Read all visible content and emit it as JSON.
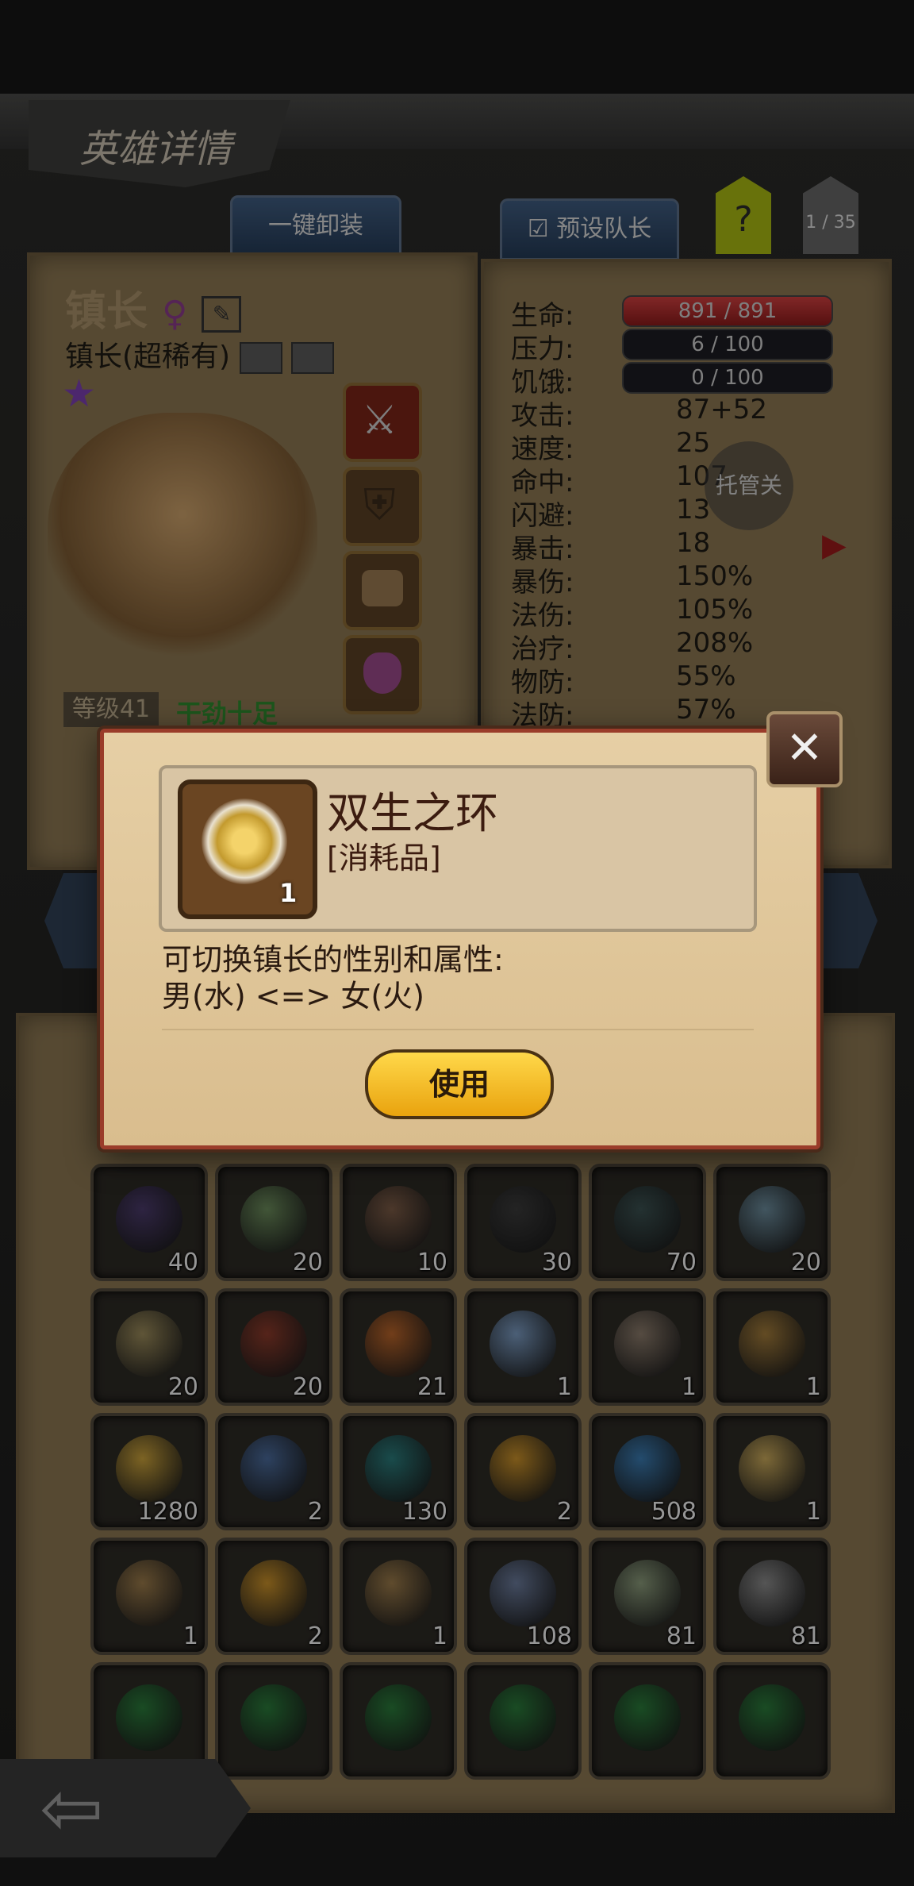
{
  "header": {
    "title": "英雄详情",
    "unequip_label": "一键卸装",
    "leader_label": "预设队长",
    "help_label": "?",
    "page_indicator": "1 / 35"
  },
  "hero": {
    "name": "镇长",
    "gender_icon": "female-symbol-icon",
    "subtitle": "镇长(超稀有)",
    "star": "★",
    "level": "等级41",
    "mood": "干劲十足",
    "star_color": "#7b3fb0"
  },
  "stats": {
    "hp": {
      "label": "生命:",
      "value": "891 / 891"
    },
    "stress": {
      "label": "压力:",
      "value": "6 / 100"
    },
    "hunger": {
      "label": "饥饿:",
      "value": "0 / 100"
    },
    "rows": [
      {
        "label": "攻击:",
        "value": "87+52"
      },
      {
        "label": "速度:",
        "value": "25"
      },
      {
        "label": "命中:",
        "value": "107"
      },
      {
        "label": "闪避:",
        "value": "13"
      },
      {
        "label": "暴击:",
        "value": "18"
      },
      {
        "label": "暴伤:",
        "value": "150%"
      },
      {
        "label": "法伤:",
        "value": "105%"
      },
      {
        "label": "治疗:",
        "value": "208%"
      },
      {
        "label": "物防:",
        "value": "55%"
      },
      {
        "label": "法防:",
        "value": "57%"
      }
    ],
    "auto_label": "托管关"
  },
  "dialog": {
    "item_name": "双生之环",
    "item_type": "[消耗品]",
    "item_qty": "1",
    "desc_line1": "可切换镇长的性别和属性:",
    "desc_line2": "男(水) <=> 女(火)",
    "use_label": "使用",
    "close_icon": "close-x-icon"
  },
  "inventory": [
    [
      {
        "icon": "hero-dark-hair",
        "qty": "40",
        "color": "#4a3a6a"
      },
      {
        "icon": "hero-green-hair",
        "qty": "20",
        "color": "#6a8a5a"
      },
      {
        "icon": "hero-brown-hair",
        "qty": "10",
        "color": "#7a5a45"
      },
      {
        "icon": "hero-black-hair",
        "qty": "30",
        "color": "#3a3a3a"
      },
      {
        "icon": "hero-teal-hair",
        "qty": "70",
        "color": "#3a5050"
      },
      {
        "icon": "hero-blue-hair",
        "qty": "20",
        "color": "#6a8a9a"
      }
    ],
    [
      {
        "icon": "hero-blonde-hair",
        "qty": "20",
        "color": "#9a8a5a"
      },
      {
        "icon": "hero-red-hair",
        "qty": "20",
        "color": "#8a3a2a"
      },
      {
        "icon": "rune-stone",
        "qty": "21",
        "color": "#b8642a"
      },
      {
        "icon": "prism-crystal",
        "qty": "1",
        "color": "#7a9ac0"
      },
      {
        "icon": "knife",
        "qty": "1",
        "color": "#8a7a6a"
      },
      {
        "icon": "scroll",
        "qty": "1",
        "color": "#a07a3a"
      }
    ],
    [
      {
        "icon": "golden-key",
        "qty": "1280",
        "color": "#c8a03a"
      },
      {
        "icon": "blue-powder",
        "qty": "2",
        "color": "#4a6a9a"
      },
      {
        "icon": "teal-emblem",
        "qty": "130",
        "color": "#2a7a7a"
      },
      {
        "icon": "gold-scepter",
        "qty": "2",
        "color": "#c8902a"
      },
      {
        "icon": "blue-potion",
        "qty": "508",
        "color": "#3a7ab0"
      },
      {
        "icon": "twin-ring",
        "qty": "1",
        "color": "#c8a85a"
      }
    ],
    [
      {
        "icon": "treasure-chest",
        "qty": "1",
        "color": "#9a7a4a"
      },
      {
        "icon": "pirate-bag",
        "qty": "2",
        "color": "#c8902a"
      },
      {
        "icon": "treasure-chest",
        "qty": "1",
        "color": "#9a7a4a"
      },
      {
        "icon": "blue-chest",
        "qty": "108",
        "color": "#6a7a9a"
      },
      {
        "icon": "green-chest",
        "qty": "81",
        "color": "#8a9a7a"
      },
      {
        "icon": "grey-chest",
        "qty": "81",
        "color": "#8a8a8a"
      }
    ],
    [
      {
        "icon": "green-orb",
        "qty": "",
        "color": "#2a7a3a"
      },
      {
        "icon": "green-orb",
        "qty": "",
        "color": "#2a7a3a"
      },
      {
        "icon": "green-orb",
        "qty": "",
        "color": "#2a7a3a"
      },
      {
        "icon": "green-orb",
        "qty": "",
        "color": "#2a7a3a"
      },
      {
        "icon": "green-orb",
        "qty": "",
        "color": "#2a7a3a"
      },
      {
        "icon": "green-orb",
        "qty": "",
        "color": "#2a7a3a"
      }
    ]
  ]
}
